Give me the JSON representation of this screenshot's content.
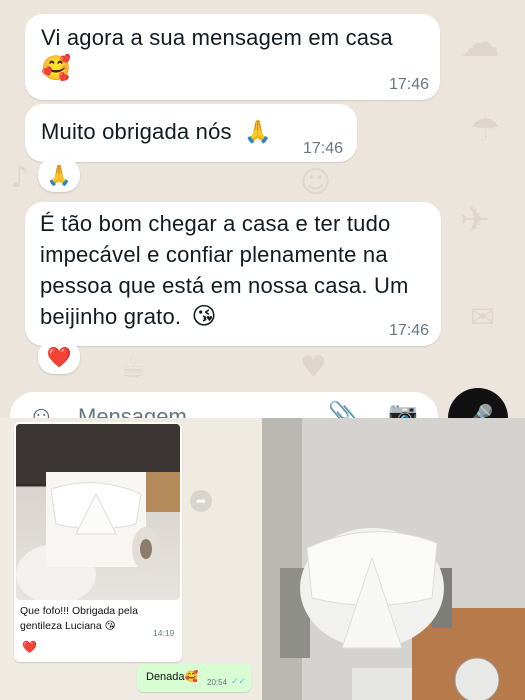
{
  "messages": [
    {
      "text": "Vi agora a sua mensagem em casa",
      "emoji": "🥰",
      "time": "17:46"
    },
    {
      "text": "Muito obrigada nós",
      "emoji": "🙏",
      "time": "17:46",
      "reaction": "🙏"
    },
    {
      "text": "É tão bom chegar a casa e ter tudo impecável e confiar plenamente na pessoa que está em nossa casa. Um beijinho grato.",
      "emoji": "😘",
      "time": "17:46",
      "reaction": "❤️"
    }
  ],
  "input": {
    "placeholder": "Mensagem",
    "sticker_icon": "sticker-icon",
    "attach_icon": "paperclip-icon",
    "camera_icon": "camera-icon",
    "mic_icon": "microphone-icon"
  },
  "embedded_chat": {
    "caption": "Que fofo!!! Obrigada pela gentileza Luciana",
    "caption_emoji": "😘",
    "caption_time": "14:19",
    "reaction": "❤️",
    "sent_text": "Denada",
    "sent_emoji": "🥰",
    "sent_time": "20:54",
    "sent_ticks": "✓✓"
  },
  "colors": {
    "chat_bg": "#ece5dd",
    "bubble_in": "#ffffff",
    "bubble_out": "#d9fdd3",
    "timestamp": "#667781",
    "read_ticks": "#53bdeb"
  }
}
